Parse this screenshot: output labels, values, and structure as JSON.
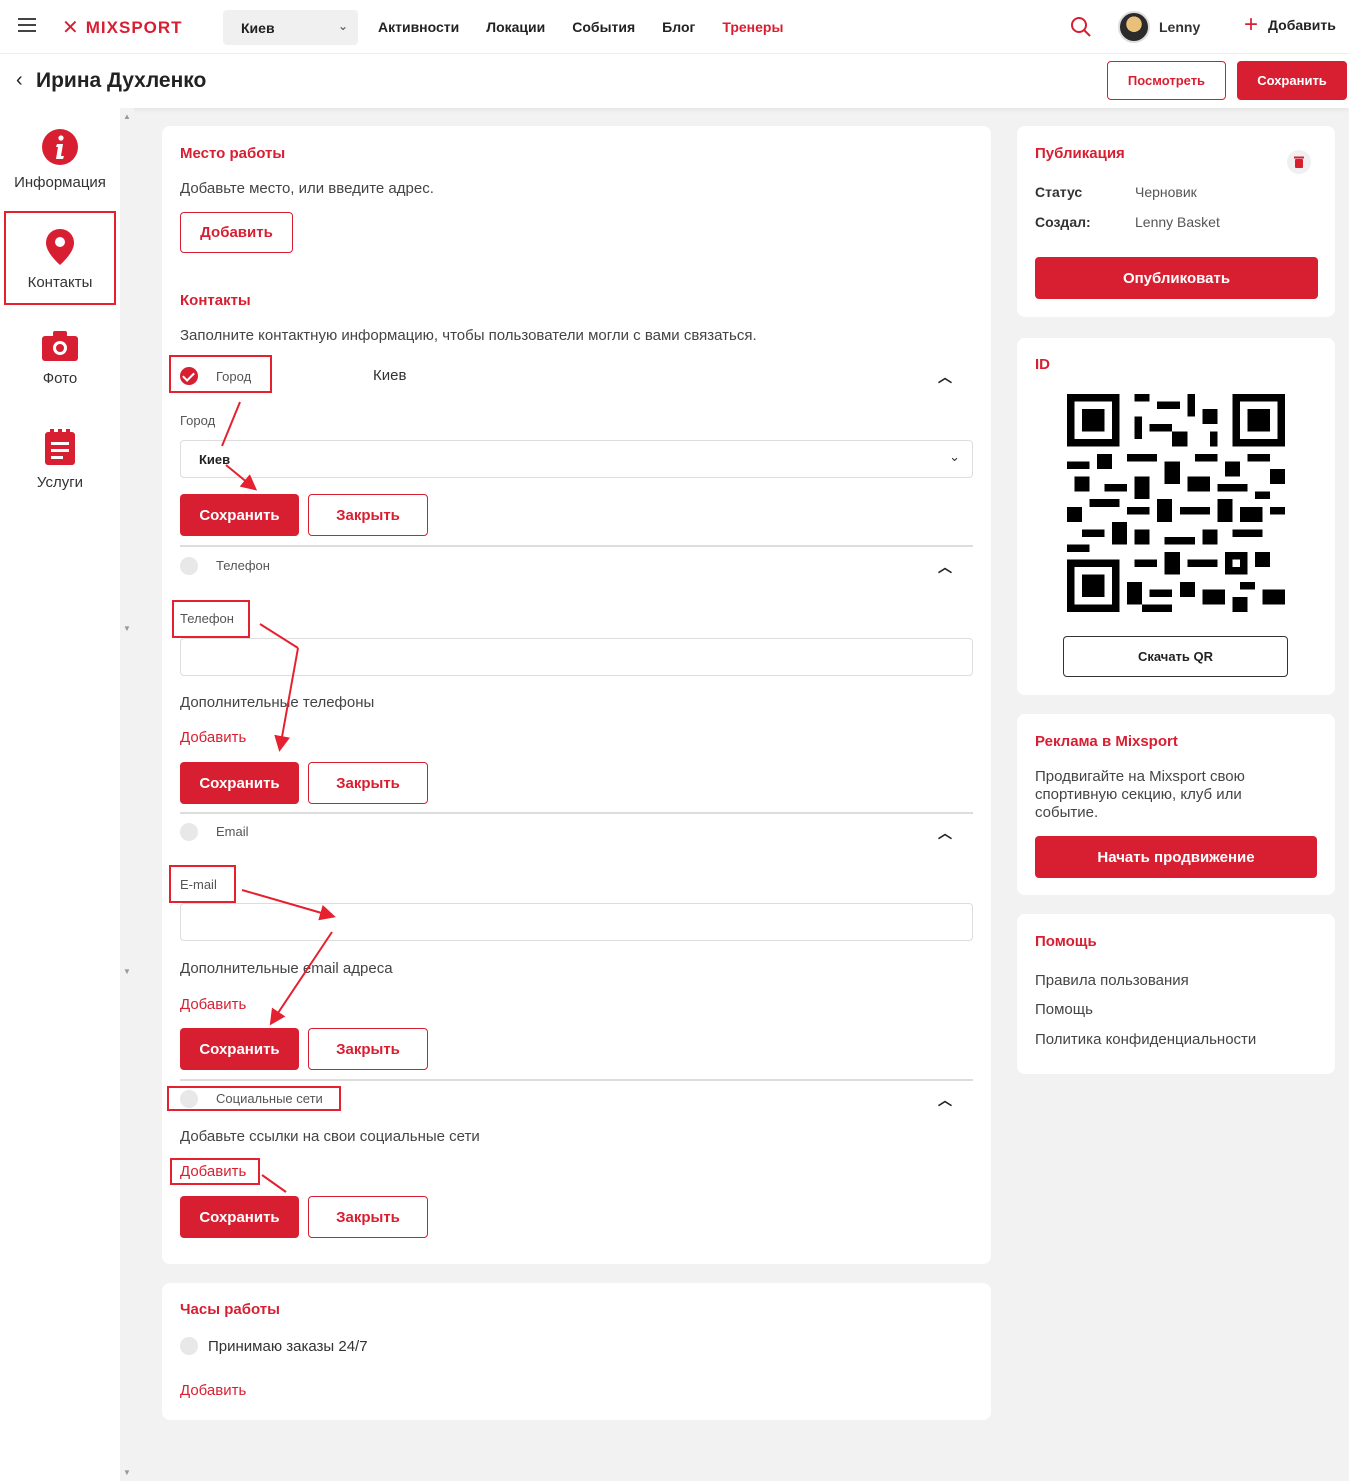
{
  "topnav": {
    "logo": "MIXSPORT",
    "city": "Киев",
    "links": [
      "Активности",
      "Локации",
      "События",
      "Блог",
      "Тренеры"
    ],
    "active_link": "Тренеры",
    "user": "Lenny",
    "add_label": "Добавить"
  },
  "pagebar": {
    "title": "Ирина Духленко",
    "view_button": "Посмотреть",
    "save_button": "Сохранить"
  },
  "sidebar": {
    "items": [
      {
        "label": "Информация",
        "icon": "info-icon"
      },
      {
        "label": "Контакты",
        "icon": "location-pin-icon"
      },
      {
        "label": "Фото",
        "icon": "camera-icon"
      },
      {
        "label": "Услуги",
        "icon": "clipboard-icon"
      }
    ],
    "selected": "Контакты"
  },
  "workplace": {
    "heading": "Место работы",
    "description": "Добавьте место, или введите адрес.",
    "add_button": "Добавить"
  },
  "contacts": {
    "heading": "Контакты",
    "description": "Заполните контактную информацию, чтобы пользователи могли с вами связаться.",
    "city": {
      "row_label": "Город",
      "row_value": "Киев",
      "field_label": "Город",
      "select_value": "Киев",
      "save": "Сохранить",
      "close": "Закрыть"
    },
    "phone": {
      "row_label": "Телефон",
      "field_label": "Телефон",
      "extra_label": "Дополнительные телефоны",
      "add": "Добавить",
      "save": "Сохранить",
      "close": "Закрыть"
    },
    "email": {
      "row_label": "Email",
      "field_label": "E-mail",
      "extra_label": "Дополнительные email адреса",
      "add": "Добавить",
      "save": "Сохранить",
      "close": "Закрыть"
    },
    "social": {
      "row_label": "Социальные сети",
      "description": "Добавьте ссылки на свои социальные сети",
      "add": "Добавить",
      "save": "Сохранить",
      "close": "Закрыть"
    }
  },
  "hours": {
    "heading": "Часы работы",
    "option": "Принимаю заказы 24/7",
    "add": "Добавить"
  },
  "publication": {
    "heading": "Публикация",
    "status_key": "Статус",
    "status_value": "Черновик",
    "creator_key": "Создал:",
    "creator_value": "Lenny Basket",
    "publish_button": "Опубликовать"
  },
  "id_card": {
    "heading": "ID",
    "download_button": "Скачать QR"
  },
  "ads": {
    "heading": "Реклама в Mixsport",
    "text": "Продвигайте на Mixsport свою спортивную секцию, клуб или событие.",
    "button": "Начать продвижение"
  },
  "help": {
    "heading": "Помощь",
    "links": [
      "Правила пользования",
      "Помощь",
      "Политика конфиденциальности"
    ]
  },
  "colors": {
    "accent": "#d81f32",
    "annotation": "#e5202f"
  }
}
